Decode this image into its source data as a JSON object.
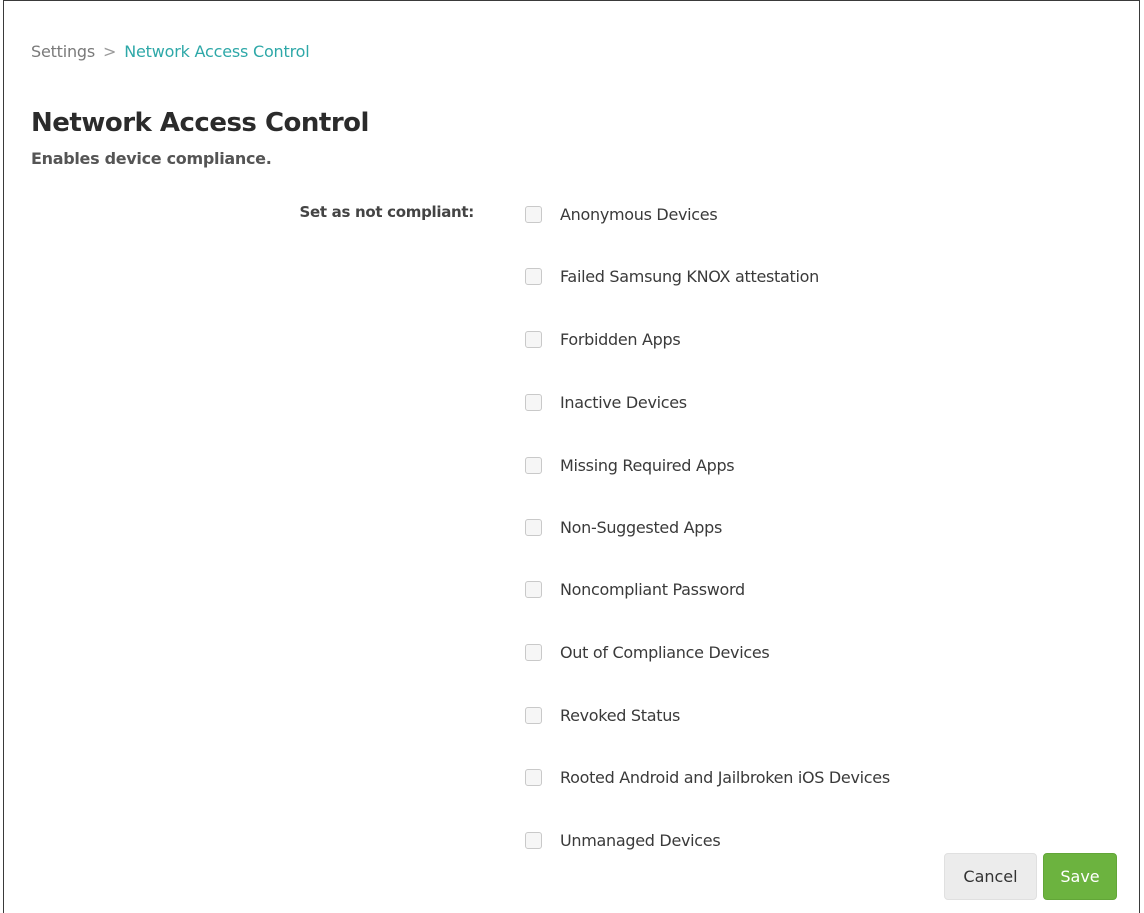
{
  "breadcrumb": {
    "root": "Settings",
    "separator": ">",
    "current": "Network Access Control"
  },
  "page": {
    "title": "Network Access Control",
    "subtitle": "Enables device compliance."
  },
  "form": {
    "label": "Set as not compliant:",
    "options": [
      {
        "label": "Anonymous Devices",
        "checked": false
      },
      {
        "label": "Failed Samsung KNOX attestation",
        "checked": false
      },
      {
        "label": "Forbidden Apps",
        "checked": false
      },
      {
        "label": "Inactive Devices",
        "checked": false
      },
      {
        "label": "Missing Required Apps",
        "checked": false
      },
      {
        "label": "Non-Suggested Apps",
        "checked": false
      },
      {
        "label": "Noncompliant Password",
        "checked": false
      },
      {
        "label": "Out of Compliance Devices",
        "checked": false
      },
      {
        "label": "Revoked Status",
        "checked": false
      },
      {
        "label": "Rooted Android and Jailbroken iOS Devices",
        "checked": false
      },
      {
        "label": "Unmanaged Devices",
        "checked": false
      }
    ]
  },
  "actions": {
    "cancel_label": "Cancel",
    "save_label": "Save"
  },
  "colors": {
    "link": "#2ea8a8",
    "save": "#6cb33f"
  }
}
